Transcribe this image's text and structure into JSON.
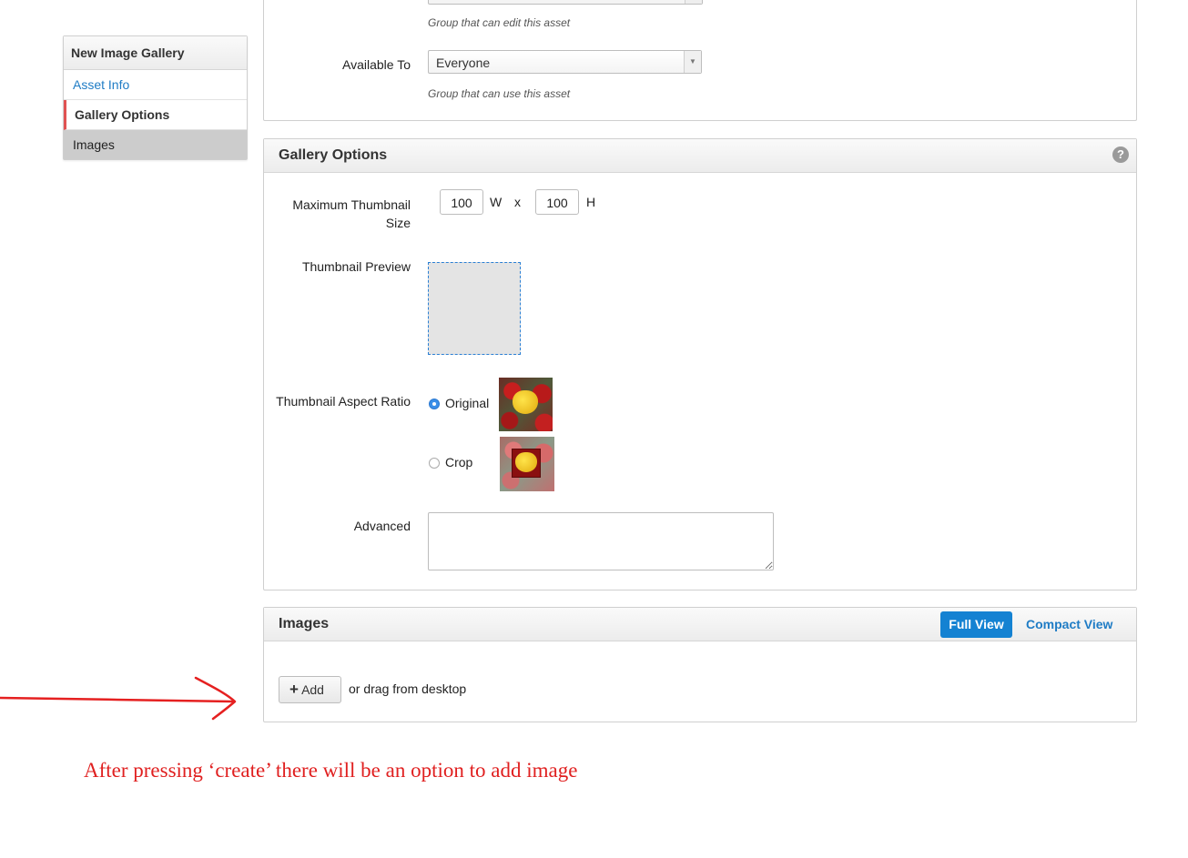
{
  "sidebar": {
    "title": "New Image Gallery",
    "items": [
      {
        "label": "Asset Info"
      },
      {
        "label": "Gallery Options"
      },
      {
        "label": "Images"
      }
    ]
  },
  "asset_panel": {
    "edit_hint": "Group that can edit this asset",
    "available_label": "Available To",
    "available_value": "Everyone",
    "use_hint": "Group that can use this asset"
  },
  "gallery_options": {
    "title": "Gallery Options",
    "help_icon": "question-circle-icon",
    "max_thumb_label_1": "Maximum Thumbnail",
    "max_thumb_label_2": "Size",
    "width_value": "100",
    "width_unit": "W",
    "times": "x",
    "height_value": "100",
    "height_unit": "H",
    "preview_label": "Thumbnail Preview",
    "aspect_label": "Thumbnail Aspect Ratio",
    "option_original": "Original",
    "option_crop": "Crop",
    "selected_option": "Original",
    "advanced_label": "Advanced",
    "advanced_value": ""
  },
  "images_panel": {
    "title": "Images",
    "full_view": "Full View",
    "compact_view": "Compact View",
    "add_label": "Add",
    "drag_text": "or drag from desktop"
  },
  "annotation": {
    "text": "After pressing ‘create’ there will be an option to add image",
    "color": "#e02020"
  }
}
